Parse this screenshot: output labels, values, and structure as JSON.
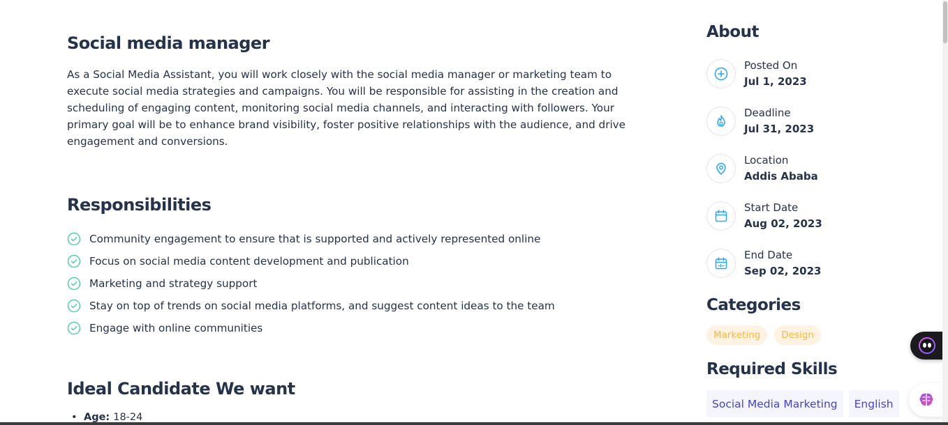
{
  "main": {
    "title": "Social media manager",
    "description": "As a Social Media Assistant, you will work closely with the social media manager or marketing team to execute social media strategies and campaigns. You will be responsible for assisting in the creation and scheduling of engaging content, monitoring social media channels, and interacting with followers. Your primary goal will be to enhance brand visibility, foster positive relationships with the audience, and drive engagement and conversions.",
    "responsibilities_title": "Responsibilities",
    "responsibilities": [
      "Community engagement to ensure that is supported and actively represented online",
      "Focus on social media content development and publication",
      "Marketing and strategy support",
      "Stay on top of trends on social media platforms, and suggest content ideas to the team",
      "Engage with online communities"
    ],
    "ideal_title": "Ideal Candidate We want",
    "ideal": [
      {
        "key": "Age:",
        "value": "18-24"
      }
    ]
  },
  "sidebar": {
    "about_title": "About",
    "about": [
      {
        "label": "Posted On",
        "value": "Jul 1, 2023",
        "icon": "plus-circle-icon"
      },
      {
        "label": "Deadline",
        "value": "Jul 31, 2023",
        "icon": "fire-icon"
      },
      {
        "label": "Location",
        "value": "Addis Ababa",
        "icon": "location-pin-icon"
      },
      {
        "label": "Start Date",
        "value": "Aug 02, 2023",
        "icon": "calendar-icon"
      },
      {
        "label": "End Date",
        "value": "Sep 02, 2023",
        "icon": "calendar-check-icon"
      }
    ],
    "categories_title": "Categories",
    "categories": [
      "Marketing",
      "Design"
    ],
    "skills_title": "Required Skills",
    "skills": [
      "Social Media Marketing",
      "English"
    ]
  },
  "colors": {
    "heading": "#25324B",
    "accent": "#26A4FF",
    "check": "#56CDAD",
    "category_bg": "#FEF2E2",
    "category_text": "#FFB836",
    "skill_bg": "#F4F5FF",
    "skill_text": "#4640DE"
  }
}
